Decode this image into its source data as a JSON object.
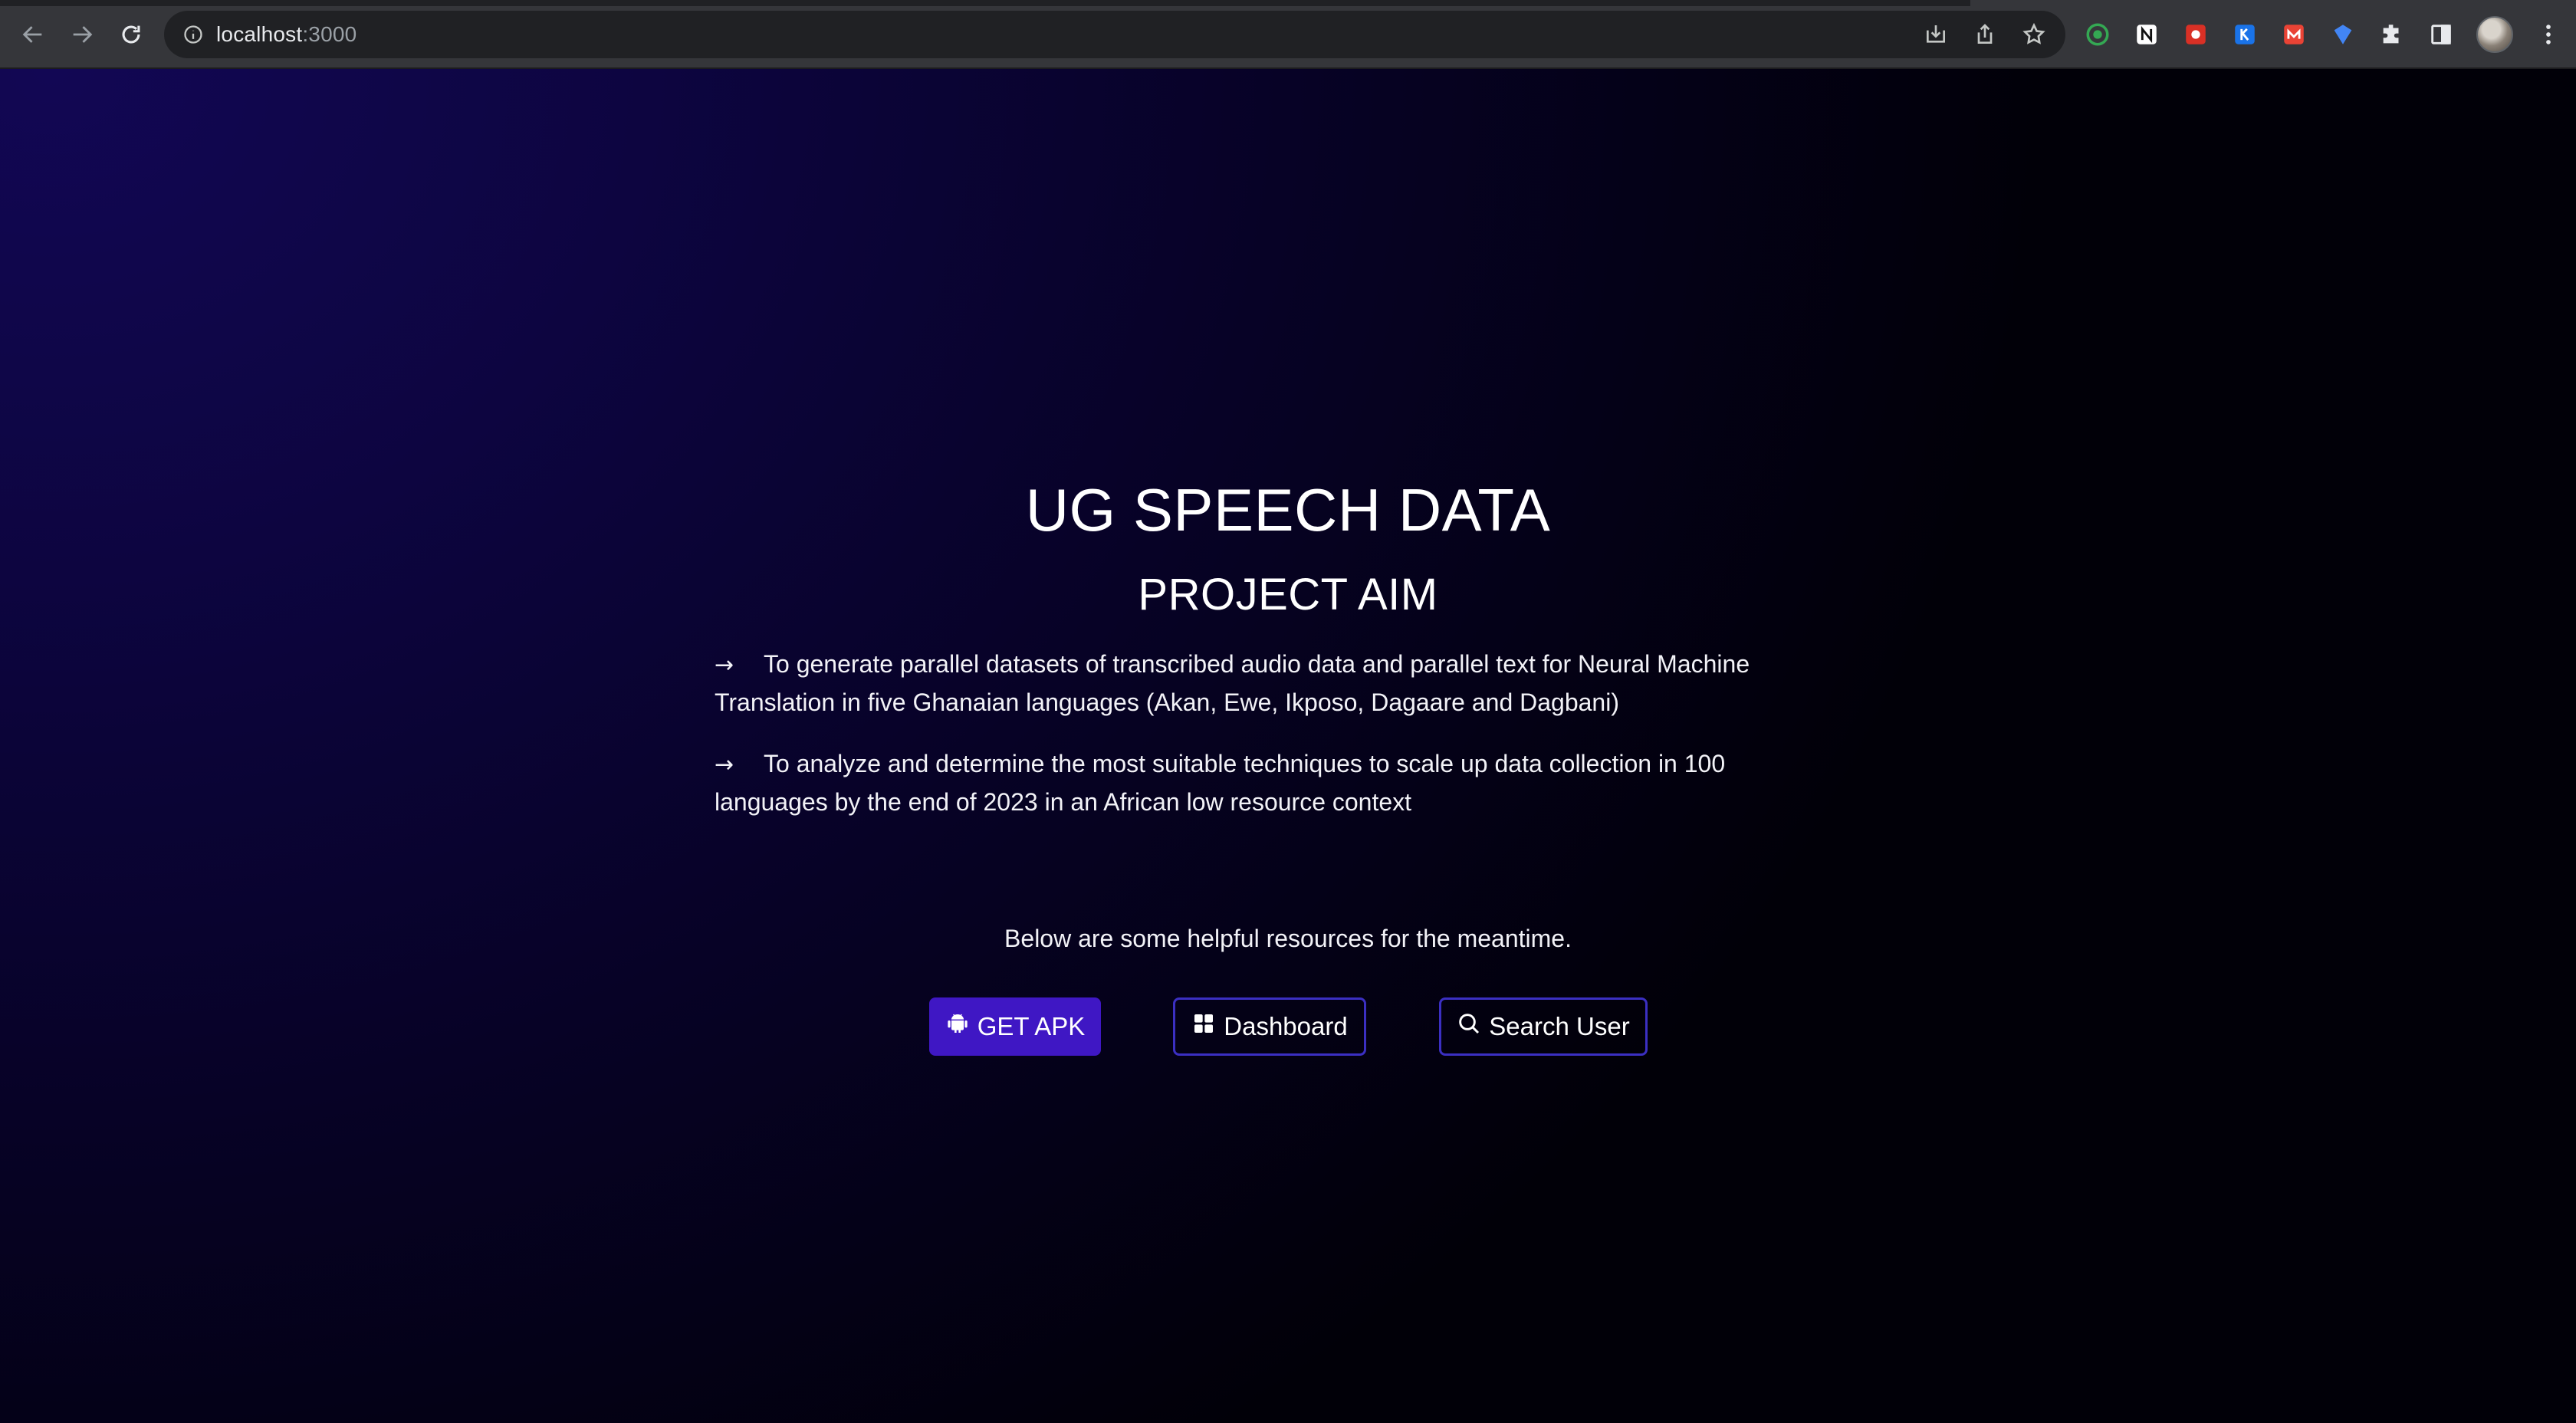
{
  "browser": {
    "url_host": "localhost",
    "url_port": ":3000",
    "nav_icons": [
      "back-arrow-icon",
      "forward-arrow-icon",
      "reload-icon"
    ],
    "omnibox_icons": [
      "site-info-icon",
      "install-app-icon",
      "share-icon",
      "bookmark-star-icon"
    ],
    "extensions": [
      {
        "name": "circle-extension-icon",
        "color": "#34a853"
      },
      {
        "name": "notion-extension-icon",
        "color": "#ffffff"
      },
      {
        "name": "red-puzzle-extension-icon",
        "color": "#d93025"
      },
      {
        "name": "blue-k-extension-icon",
        "color": "#1a73e8"
      },
      {
        "name": "red-m-extension-icon",
        "color": "#ea4335"
      },
      {
        "name": "blue-shield-extension-icon",
        "color": "#4285f4"
      }
    ],
    "toolbar_icons": [
      "extensions-puzzle-icon",
      "side-panel-icon",
      "profile-avatar",
      "menu-kebab-icon"
    ]
  },
  "hero": {
    "title": "UG SPEECH DATA",
    "subtitle": "PROJECT AIM",
    "arrow": "→",
    "aims": [
      "To generate parallel datasets of transcribed audio data and parallel text for Neural Machine Translation in five Ghanaian languages (Akan, Ewe, Ikposo, Dagaare and Dagbani)",
      "To analyze and determine the most suitable techniques to scale up data collection in 100 languages by the end of 2023 in an African low resource context"
    ],
    "helper_text": "Below are some helpful resources for the meantime."
  },
  "actions": {
    "get_apk": "GET APK",
    "dashboard": "Dashboard",
    "search_user": "Search User"
  },
  "colors": {
    "primary_button": "#3f17c4",
    "outline_border": "#3b2fc2",
    "background_top": "#120754",
    "background_bottom": "#010008"
  }
}
